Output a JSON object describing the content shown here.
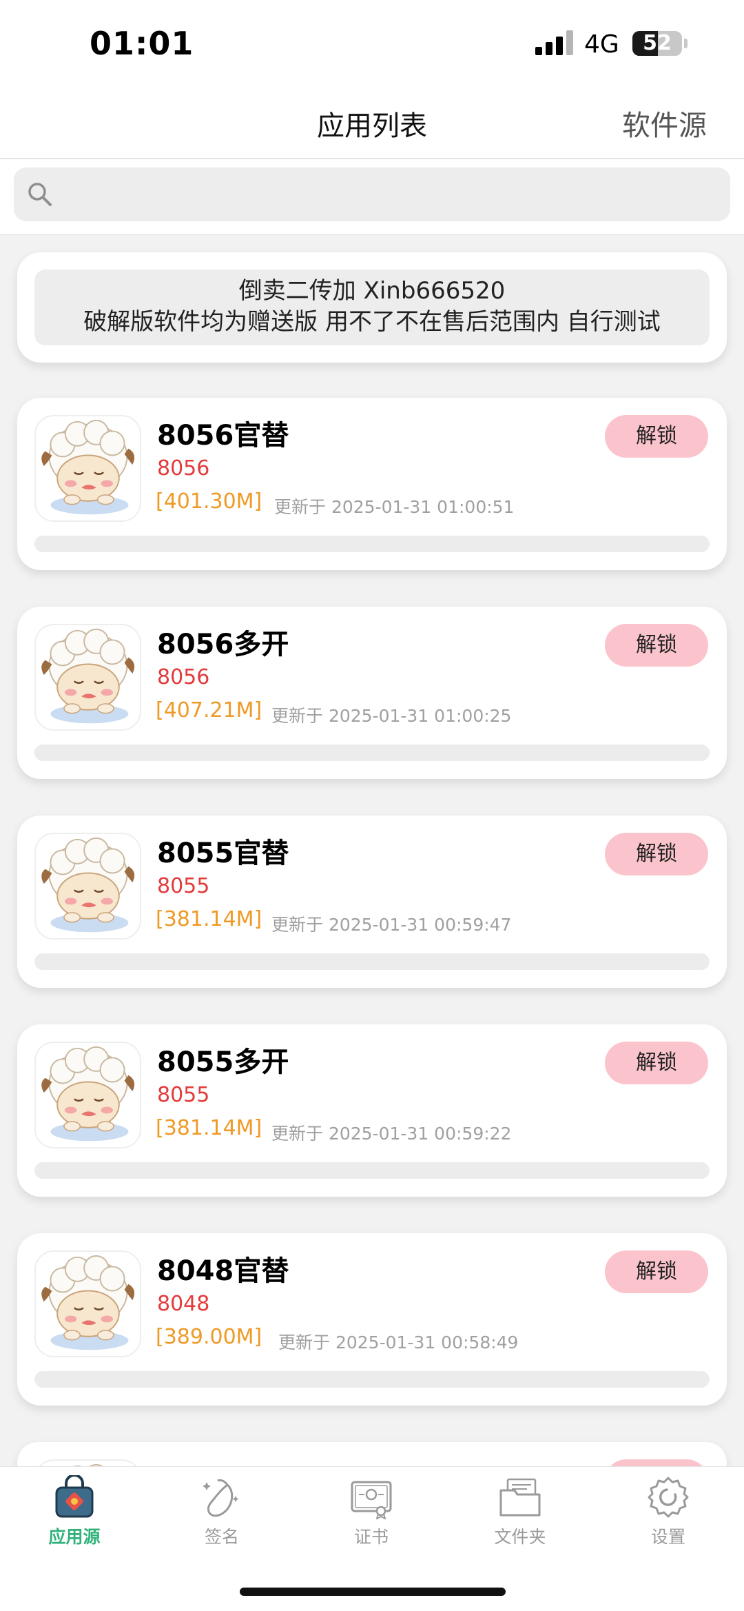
{
  "status": {
    "time": "01:01",
    "network": "4G",
    "battery": "52",
    "battery_level": 0.52
  },
  "header": {
    "title": "应用列表",
    "right_action": "软件源"
  },
  "search": {
    "placeholder": ""
  },
  "notice": {
    "line1": "倒卖二传加 Xinb666520",
    "line2": "破解版软件均为赠送版 用不了不在售后范围内 自行测试"
  },
  "apps": [
    {
      "name": "8056官替",
      "version": "8056",
      "size": "[401.30M]",
      "updated": "更新于 2025-01-31 01:00:51",
      "button": "解锁",
      "progress": 0
    },
    {
      "name": "8056多开",
      "version": "8056",
      "size": "[407.21M]",
      "updated": "更新于 2025-01-31 01:00:25",
      "button": "解锁",
      "progress": 0
    },
    {
      "name": "8055官替",
      "version": "8055",
      "size": "[381.14M]",
      "updated": "更新于 2025-01-31 00:59:47",
      "button": "解锁",
      "progress": 0
    },
    {
      "name": "8055多开",
      "version": "8055",
      "size": "[381.14M]",
      "updated": "更新于 2025-01-31 00:59:22",
      "button": "解锁",
      "progress": 0
    },
    {
      "name": "8048官替",
      "version": "8048",
      "size": "[389.00M]",
      "updated": "更新于 2025-01-31 00:58:49",
      "button": "解锁",
      "progress": 0
    }
  ],
  "tabs": [
    {
      "label": "应用源",
      "icon": "shopping-bag-icon",
      "active": true
    },
    {
      "label": "签名",
      "icon": "mango-icon",
      "active": false
    },
    {
      "label": "证书",
      "icon": "certificate-icon",
      "active": false
    },
    {
      "label": "文件夹",
      "icon": "folder-icon",
      "active": false
    },
    {
      "label": "设置",
      "icon": "gear-icon",
      "active": false
    }
  ],
  "colors": {
    "accent": "#2fb27a",
    "unlock_button": "#fbc4cc",
    "version_text": "#e33a3a",
    "size_text": "#ef9a26"
  }
}
